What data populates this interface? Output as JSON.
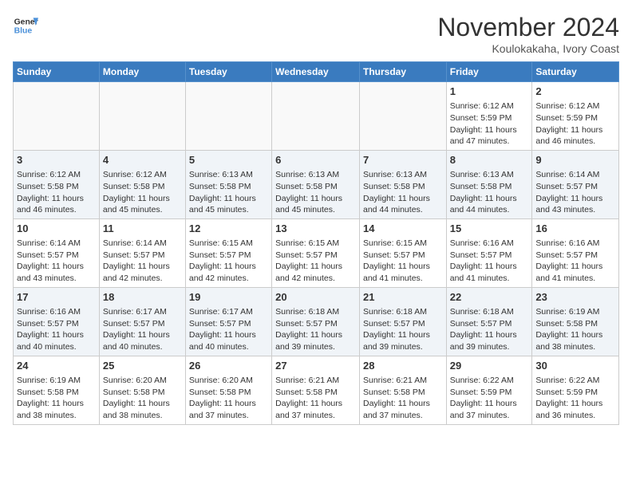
{
  "header": {
    "logo_line1": "General",
    "logo_line2": "Blue",
    "month": "November 2024",
    "location": "Koulokakaha, Ivory Coast"
  },
  "days_of_week": [
    "Sunday",
    "Monday",
    "Tuesday",
    "Wednesday",
    "Thursday",
    "Friday",
    "Saturday"
  ],
  "weeks": [
    [
      {
        "day": "",
        "empty": true
      },
      {
        "day": "",
        "empty": true
      },
      {
        "day": "",
        "empty": true
      },
      {
        "day": "",
        "empty": true
      },
      {
        "day": "",
        "empty": true
      },
      {
        "day": "1",
        "sunrise": "6:12 AM",
        "sunset": "5:59 PM",
        "daylight": "11 hours and 47 minutes."
      },
      {
        "day": "2",
        "sunrise": "6:12 AM",
        "sunset": "5:59 PM",
        "daylight": "11 hours and 46 minutes."
      }
    ],
    [
      {
        "day": "3",
        "sunrise": "6:12 AM",
        "sunset": "5:58 PM",
        "daylight": "11 hours and 46 minutes."
      },
      {
        "day": "4",
        "sunrise": "6:12 AM",
        "sunset": "5:58 PM",
        "daylight": "11 hours and 45 minutes."
      },
      {
        "day": "5",
        "sunrise": "6:13 AM",
        "sunset": "5:58 PM",
        "daylight": "11 hours and 45 minutes."
      },
      {
        "day": "6",
        "sunrise": "6:13 AM",
        "sunset": "5:58 PM",
        "daylight": "11 hours and 45 minutes."
      },
      {
        "day": "7",
        "sunrise": "6:13 AM",
        "sunset": "5:58 PM",
        "daylight": "11 hours and 44 minutes."
      },
      {
        "day": "8",
        "sunrise": "6:13 AM",
        "sunset": "5:58 PM",
        "daylight": "11 hours and 44 minutes."
      },
      {
        "day": "9",
        "sunrise": "6:14 AM",
        "sunset": "5:57 PM",
        "daylight": "11 hours and 43 minutes."
      }
    ],
    [
      {
        "day": "10",
        "sunrise": "6:14 AM",
        "sunset": "5:57 PM",
        "daylight": "11 hours and 43 minutes."
      },
      {
        "day": "11",
        "sunrise": "6:14 AM",
        "sunset": "5:57 PM",
        "daylight": "11 hours and 42 minutes."
      },
      {
        "day": "12",
        "sunrise": "6:15 AM",
        "sunset": "5:57 PM",
        "daylight": "11 hours and 42 minutes."
      },
      {
        "day": "13",
        "sunrise": "6:15 AM",
        "sunset": "5:57 PM",
        "daylight": "11 hours and 42 minutes."
      },
      {
        "day": "14",
        "sunrise": "6:15 AM",
        "sunset": "5:57 PM",
        "daylight": "11 hours and 41 minutes."
      },
      {
        "day": "15",
        "sunrise": "6:16 AM",
        "sunset": "5:57 PM",
        "daylight": "11 hours and 41 minutes."
      },
      {
        "day": "16",
        "sunrise": "6:16 AM",
        "sunset": "5:57 PM",
        "daylight": "11 hours and 41 minutes."
      }
    ],
    [
      {
        "day": "17",
        "sunrise": "6:16 AM",
        "sunset": "5:57 PM",
        "daylight": "11 hours and 40 minutes."
      },
      {
        "day": "18",
        "sunrise": "6:17 AM",
        "sunset": "5:57 PM",
        "daylight": "11 hours and 40 minutes."
      },
      {
        "day": "19",
        "sunrise": "6:17 AM",
        "sunset": "5:57 PM",
        "daylight": "11 hours and 40 minutes."
      },
      {
        "day": "20",
        "sunrise": "6:18 AM",
        "sunset": "5:57 PM",
        "daylight": "11 hours and 39 minutes."
      },
      {
        "day": "21",
        "sunrise": "6:18 AM",
        "sunset": "5:57 PM",
        "daylight": "11 hours and 39 minutes."
      },
      {
        "day": "22",
        "sunrise": "6:18 AM",
        "sunset": "5:57 PM",
        "daylight": "11 hours and 39 minutes."
      },
      {
        "day": "23",
        "sunrise": "6:19 AM",
        "sunset": "5:58 PM",
        "daylight": "11 hours and 38 minutes."
      }
    ],
    [
      {
        "day": "24",
        "sunrise": "6:19 AM",
        "sunset": "5:58 PM",
        "daylight": "11 hours and 38 minutes."
      },
      {
        "day": "25",
        "sunrise": "6:20 AM",
        "sunset": "5:58 PM",
        "daylight": "11 hours and 38 minutes."
      },
      {
        "day": "26",
        "sunrise": "6:20 AM",
        "sunset": "5:58 PM",
        "daylight": "11 hours and 37 minutes."
      },
      {
        "day": "27",
        "sunrise": "6:21 AM",
        "sunset": "5:58 PM",
        "daylight": "11 hours and 37 minutes."
      },
      {
        "day": "28",
        "sunrise": "6:21 AM",
        "sunset": "5:58 PM",
        "daylight": "11 hours and 37 minutes."
      },
      {
        "day": "29",
        "sunrise": "6:22 AM",
        "sunset": "5:59 PM",
        "daylight": "11 hours and 37 minutes."
      },
      {
        "day": "30",
        "sunrise": "6:22 AM",
        "sunset": "5:59 PM",
        "daylight": "11 hours and 36 minutes."
      }
    ]
  ]
}
